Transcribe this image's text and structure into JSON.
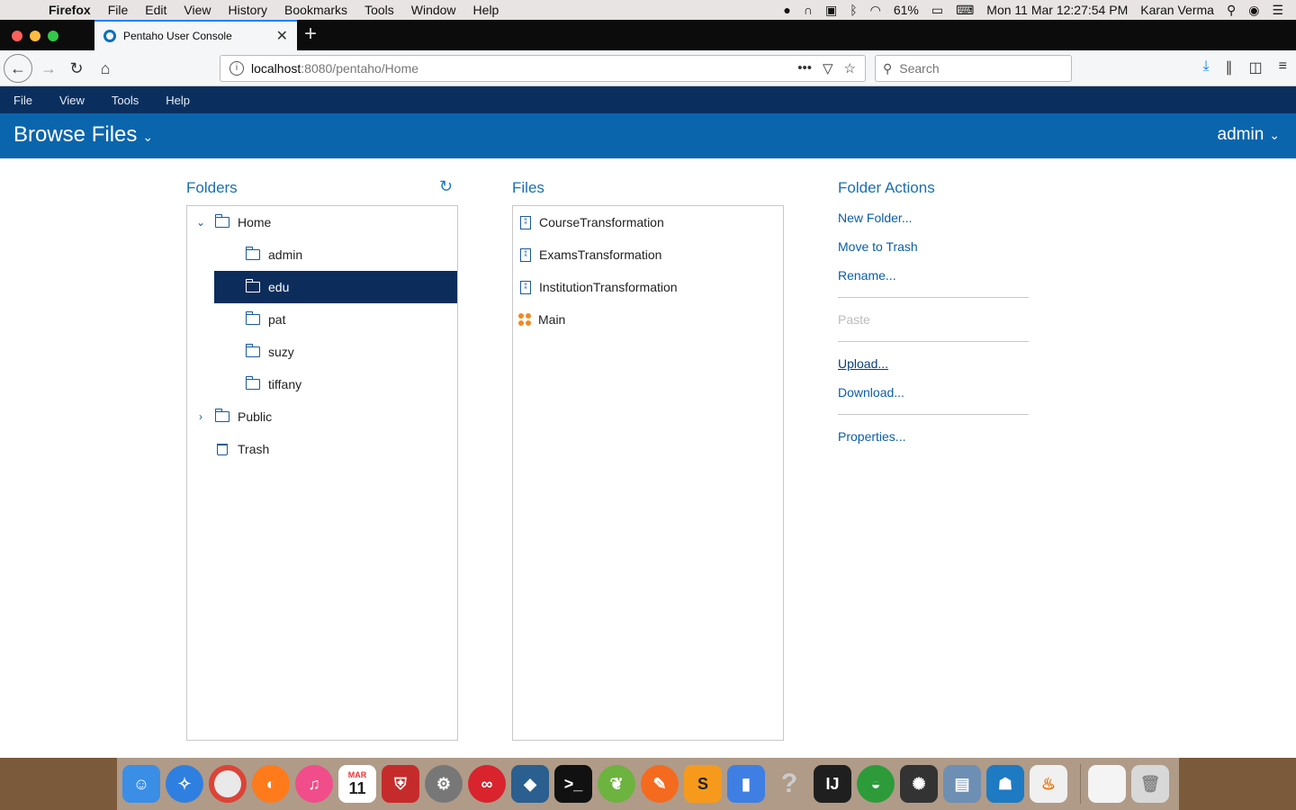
{
  "mac_menubar": {
    "app_name": "Firefox",
    "items": [
      "File",
      "Edit",
      "View",
      "History",
      "Bookmarks",
      "Tools",
      "Window",
      "Help"
    ],
    "battery": "61%",
    "datetime": "Mon 11 Mar  12:27:54 PM",
    "user": "Karan Verma"
  },
  "browser": {
    "tab_title": "Pentaho User Console",
    "url_host": "localhost",
    "url_path": ":8080/pentaho/Home",
    "search_placeholder": "Search"
  },
  "pentaho": {
    "menu": [
      "File",
      "View",
      "Tools",
      "Help"
    ],
    "perspective": "Browse Files",
    "user": "admin"
  },
  "folders": {
    "title": "Folders",
    "items": [
      {
        "label": "Home"
      },
      {
        "label": "admin"
      },
      {
        "label": "edu"
      },
      {
        "label": "pat"
      },
      {
        "label": "suzy"
      },
      {
        "label": "tiffany"
      },
      {
        "label": "Public"
      },
      {
        "label": "Trash"
      }
    ],
    "selected": "edu"
  },
  "files": {
    "title": "Files",
    "items": [
      {
        "label": "CourseTransformation"
      },
      {
        "label": "ExamsTransformation"
      },
      {
        "label": "InstitutionTransformation"
      },
      {
        "label": "Main"
      }
    ]
  },
  "folder_actions": {
    "title": "Folder Actions",
    "new_folder": "New Folder...",
    "move_to_trash": "Move to Trash",
    "rename": "Rename...",
    "paste": "Paste",
    "upload": "Upload...",
    "download": "Download...",
    "properties": "Properties..."
  },
  "dock": {
    "calendar_month": "MAR",
    "calendar_day": "11"
  }
}
